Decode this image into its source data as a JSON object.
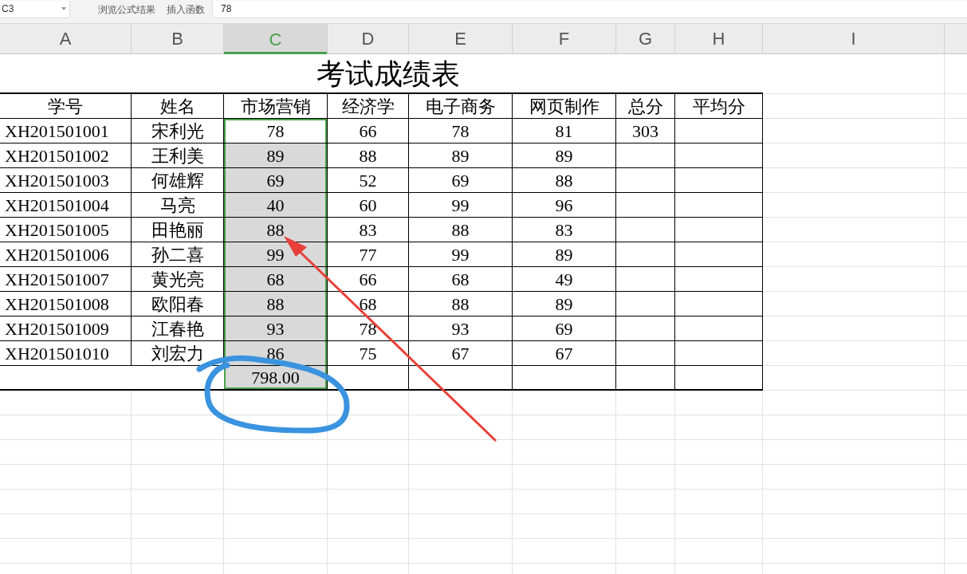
{
  "name_box": {
    "value": "C3"
  },
  "formula_toolbar": [
    {
      "label": "浏览公式结果"
    },
    {
      "label": "插入函数"
    }
  ],
  "formula_field": {
    "value": "78"
  },
  "columns": [
    {
      "label": "A",
      "selected": false
    },
    {
      "label": "B",
      "selected": false
    },
    {
      "label": "C",
      "selected": true
    },
    {
      "label": "D",
      "selected": false
    },
    {
      "label": "E",
      "selected": false
    },
    {
      "label": "F",
      "selected": false
    },
    {
      "label": "G",
      "selected": false
    },
    {
      "label": "H",
      "selected": false
    },
    {
      "label": "I",
      "selected": false
    }
  ],
  "sheet": {
    "title": "考试成绩表",
    "header": [
      "学号",
      "姓名",
      "市场营销",
      "经济学",
      "电子商务",
      "网页制作",
      "总分",
      "平均分"
    ],
    "rows": [
      {
        "cells": [
          "XH201501001",
          "宋利光",
          "78",
          "66",
          "78",
          "81",
          "303"
        ],
        "active": true
      },
      {
        "cells": [
          "XH201501002",
          "王利美",
          "89",
          "88",
          "89",
          "89"
        ],
        "active": false
      },
      {
        "cells": [
          "XH201501003",
          "何雄辉",
          "69",
          "52",
          "69",
          "88"
        ],
        "active": false
      },
      {
        "cells": [
          "XH201501004",
          "马亮",
          "40",
          "60",
          "99",
          "96"
        ],
        "active": false
      },
      {
        "cells": [
          "XH201501005",
          "田艳丽",
          "88",
          "83",
          "88",
          "83"
        ],
        "active": false
      },
      {
        "cells": [
          "XH201501006",
          "孙二喜",
          "99",
          "77",
          "99",
          "89"
        ],
        "active": false
      },
      {
        "cells": [
          "XH201501007",
          "黄光亮",
          "68",
          "66",
          "68",
          "49"
        ],
        "active": false
      },
      {
        "cells": [
          "XH201501008",
          "欧阳春",
          "88",
          "68",
          "88",
          "89"
        ],
        "active": false
      },
      {
        "cells": [
          "XH201501009",
          "江春艳",
          "93",
          "78",
          "93",
          "69"
        ],
        "active": false
      },
      {
        "cells": [
          "XH201501010",
          "刘宏力",
          "86",
          "75",
          "67",
          "67"
        ],
        "active": false
      }
    ],
    "total_row": {
      "cells": [
        null,
        null,
        "798.00"
      ],
      "active": false
    }
  }
}
